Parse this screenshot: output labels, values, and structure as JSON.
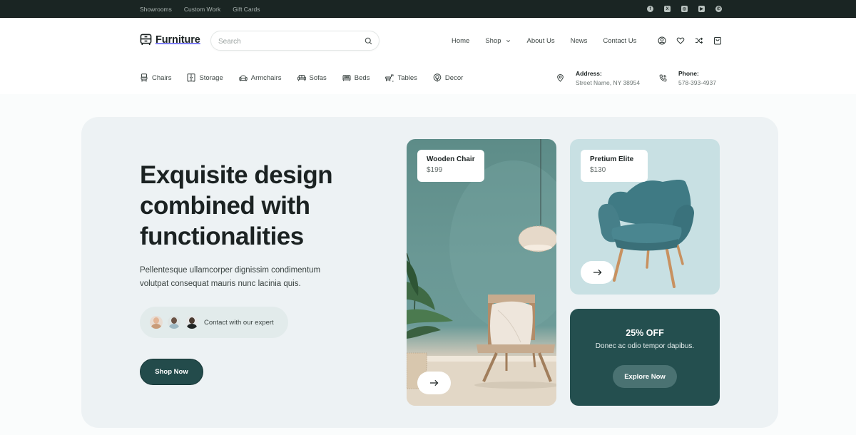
{
  "topbar": {
    "links": [
      "Showrooms",
      "Custom Work",
      "Gift Cards"
    ],
    "social": [
      {
        "icon": "facebook-icon",
        "glyph": "f"
      },
      {
        "icon": "x-twitter-icon",
        "glyph": "X"
      },
      {
        "icon": "instagram-icon",
        "glyph": "◎"
      },
      {
        "icon": "youtube-icon",
        "glyph": "▶"
      },
      {
        "icon": "whatsapp-icon",
        "glyph": "✆"
      }
    ]
  },
  "header": {
    "logo_text": "Furniture",
    "search": {
      "placeholder": "Search",
      "value": ""
    },
    "nav": [
      "Home",
      "Shop",
      "About Us",
      "News",
      "Contact Us"
    ],
    "icons": [
      "user-icon",
      "heart-icon",
      "shuffle-icon",
      "cart-icon"
    ],
    "categories": [
      "Chairs",
      "Storage",
      "Armchairs",
      "Sofas",
      "Beds",
      "Tables",
      "Decor"
    ],
    "address": {
      "label": "Address:",
      "value": "Street Name, NY 38954"
    },
    "phone": {
      "label": "Phone:",
      "value": "578-393-4937"
    }
  },
  "hero": {
    "title": "Exquisite design combined with functionalities",
    "description": "Pellentesque ullamcorper dignissim condimentum volutpat consequat mauris nunc lacinia quis.",
    "expert_label": "Contact with our expert",
    "shop_button": "Shop Now"
  },
  "products": [
    {
      "name": "Wooden Chair",
      "price": "$199"
    },
    {
      "name": "Pretium Elite",
      "price": "$130"
    }
  ],
  "promo": {
    "title": "25% OFF",
    "subtitle": "Donec ac odio tempor dapibus.",
    "button": "Explore Now"
  },
  "colors": {
    "topbar_bg": "#1a2523",
    "brand_dark_teal": "#234b4b",
    "hero_bg": "#edf2f4",
    "armchair_card_bg": "#c8e0e3"
  }
}
